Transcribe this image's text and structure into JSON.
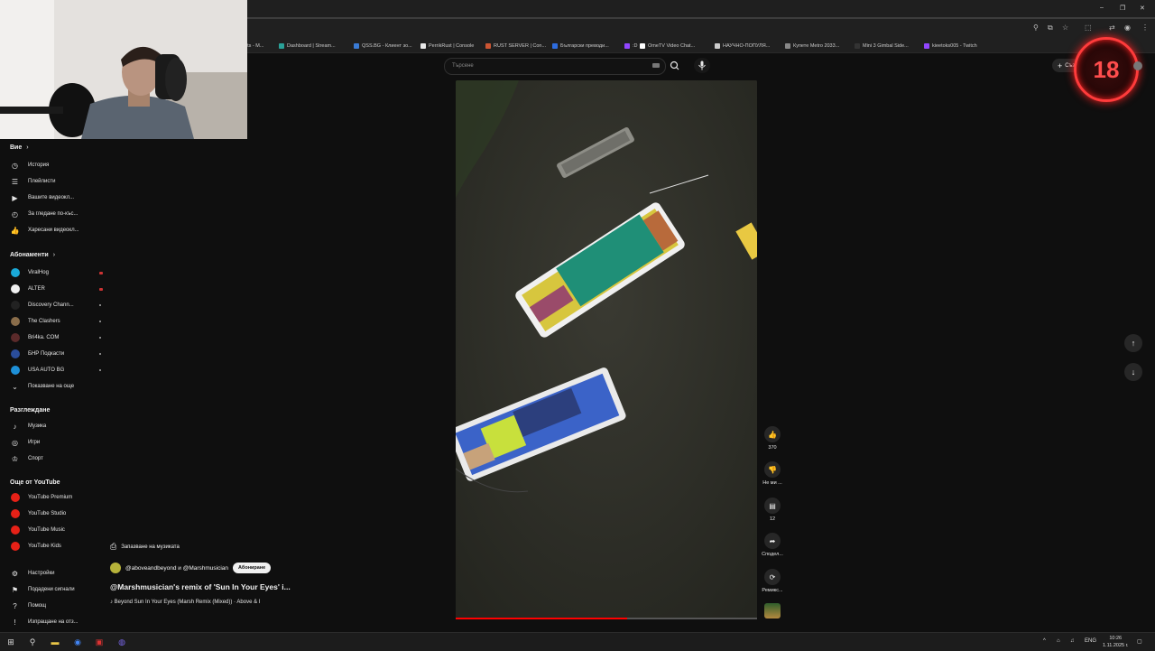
{
  "browser": {
    "bookmarks": [
      {
        "label": "ents - M...",
        "color": "#4a4a4a"
      },
      {
        "label": "Dashboard | Stream...",
        "color": "#2aa198"
      },
      {
        "label": "QSS.BG - Клиент зо...",
        "color": "#3a7bd5"
      },
      {
        "label": "PerrikRust | Console",
        "color": "#e8e8e8"
      },
      {
        "label": "RUST SERVER | Con...",
        "color": "#cc5533"
      },
      {
        "label": "Български преводи...",
        "color": "#2d6cdf"
      },
      {
        "label": ":D",
        "color": "#9146ff"
      },
      {
        "label": "OmeTV Video Chat...",
        "color": "#ffffff"
      },
      {
        "label": "НАУЧНО-ПОПУЛЯ...",
        "color": "#cccccc"
      },
      {
        "label": "Купете Metro 2033...",
        "color": "#888888"
      },
      {
        "label": "Mini 3 Gimbal Side...",
        "color": "#333333"
      },
      {
        "label": "kieetoks005 - Twitch",
        "color": "#9146ff"
      }
    ]
  },
  "header": {
    "search_placeholder": "Търсене",
    "create_label": "Създаване"
  },
  "age_badge": "18",
  "sidebar": {
    "you_label": "Вие",
    "you_items": [
      {
        "label": "История",
        "icon": "history-icon",
        "glyph": "◷"
      },
      {
        "label": "Плейлисти",
        "icon": "playlist-icon",
        "glyph": "☰"
      },
      {
        "label": "Вашите видеокл...",
        "icon": "your-videos-icon",
        "glyph": "▶"
      },
      {
        "label": "За гледане по-къс...",
        "icon": "watch-later-icon",
        "glyph": "◴"
      },
      {
        "label": "Харесани видеокл...",
        "icon": "like-icon",
        "glyph": "👍"
      }
    ],
    "subscriptions_label": "Абонаменти",
    "subscriptions": [
      {
        "label": "ViralHog",
        "color": "#1aa9d8",
        "live": true
      },
      {
        "label": "ALTER",
        "color": "#f1f1f1",
        "live": true
      },
      {
        "label": "Discovery Chann...",
        "color": "#222222",
        "live": false
      },
      {
        "label": "The Clashers",
        "color": "#8a6d4a",
        "live": false
      },
      {
        "label": "Bri4ka. COM",
        "color": "#5b2a2a",
        "live": false
      },
      {
        "label": "БНР Подкасти",
        "color": "#2a4d9b",
        "live": false
      },
      {
        "label": "USA AUTO BG",
        "color": "#1e90d8",
        "live": false
      }
    ],
    "show_more_label": "Показване на още",
    "explore_label": "Разглеждане",
    "explore_items": [
      {
        "label": "Музика",
        "icon": "music-icon",
        "glyph": "♪"
      },
      {
        "label": "Игри",
        "icon": "gaming-icon",
        "glyph": "◎"
      },
      {
        "label": "Спорт",
        "icon": "trophy-icon",
        "glyph": "♔"
      }
    ],
    "more_label": "Още от YouTube",
    "more_items": [
      {
        "label": "YouTube Premium"
      },
      {
        "label": "YouTube Studio"
      },
      {
        "label": "YouTube Music"
      },
      {
        "label": "YouTube Kids"
      }
    ],
    "footer_items": [
      {
        "label": "Настройки",
        "icon": "settings-icon",
        "glyph": "⚙"
      },
      {
        "label": "Подадени сигнали",
        "icon": "flag-icon",
        "glyph": "⚑"
      },
      {
        "label": "Помощ",
        "icon": "help-icon",
        "glyph": "?"
      },
      {
        "label": "Изпращане на отз...",
        "icon": "feedback-icon",
        "glyph": "!"
      }
    ]
  },
  "short": {
    "save_music_label": "Запазване на музиката",
    "channels": "@aboveandbeyond и @Marshmusician",
    "subscribe_label": "Абониране",
    "title": "@Marshmusician's remix of 'Sun In Your Eyes' i...",
    "music_line": "♪ Beyond    Sun In Your Eyes (Marsh Remix (Mixed)) · Above & I",
    "progress_fraction": 0.57
  },
  "actions": {
    "likes": "370",
    "dislike_label": "Не ми ...",
    "comments": "12",
    "share_label": "Сподел...",
    "remix_label": "Ремикс..."
  },
  "taskbar": {
    "lang": "ENG",
    "time": "10:26",
    "date": "1.11.2025 г."
  }
}
